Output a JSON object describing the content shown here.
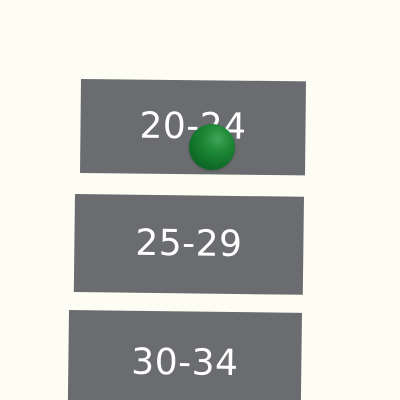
{
  "age_options": [
    {
      "label": "20-24"
    },
    {
      "label": "25-29"
    },
    {
      "label": "30-34"
    }
  ],
  "colors": {
    "background": "#fdfdf3",
    "button": "#6a6c70",
    "button_text": "#ffffff",
    "pointer": "#1f8a38"
  },
  "pointer": {
    "icon": "green-sphere-cursor"
  }
}
